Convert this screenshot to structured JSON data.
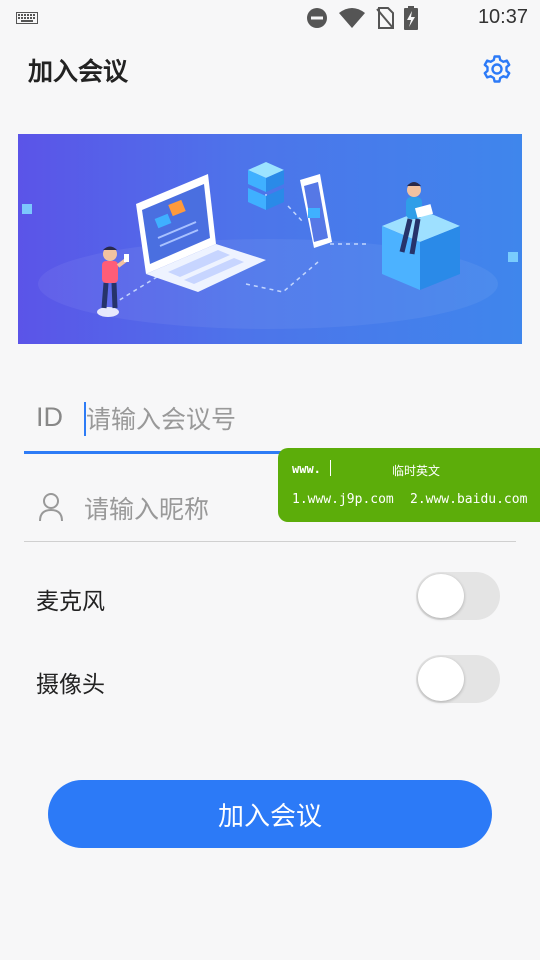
{
  "status_bar": {
    "time": "10:37",
    "icons": [
      "keyboard-icon",
      "do-not-disturb-icon",
      "wifi-icon",
      "no-sim-icon",
      "battery-charging-icon"
    ]
  },
  "header": {
    "title": "加入会议",
    "settings_icon": "gear-icon"
  },
  "form": {
    "id_prefix": "ID",
    "id_placeholder": "请输入会议号",
    "nickname_placeholder": "请输入昵称",
    "nickname_icon": "person-icon"
  },
  "toggles": [
    {
      "label": "麦克风",
      "on": false
    },
    {
      "label": "摄像头",
      "on": false
    }
  ],
  "join_button": "加入会议",
  "ime_popup": {
    "typed": "www.",
    "mode": "临时英文",
    "candidate_1": "1.www.j9p.com",
    "candidate_2": "2.www.baidu.com"
  },
  "colors": {
    "accent": "#2c7af7",
    "ime_bg": "#5cad0a",
    "banner_from": "#5b54e8",
    "banner_to": "#3f86ec"
  }
}
